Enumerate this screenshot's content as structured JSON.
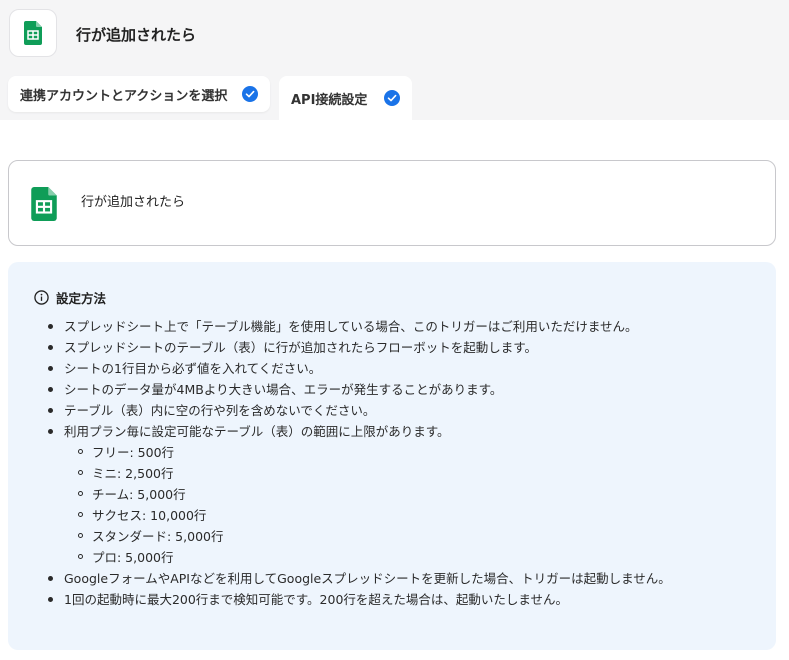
{
  "header": {
    "title": "行が追加されたら",
    "app_icon": "google-sheets-icon"
  },
  "tabs": [
    {
      "label": "連携アカウントとアクションを選択",
      "status_icon": "check-circle-icon",
      "active": false
    },
    {
      "label": "API接続設定",
      "status_icon": "check-circle-icon",
      "active": true
    }
  ],
  "trigger": {
    "label": "行が追加されたら",
    "icon": "google-sheets-icon"
  },
  "info": {
    "title": "設定方法",
    "icon": "info-circle-icon",
    "items": [
      {
        "level": 1,
        "text": "スプレッドシート上で「テーブル機能」を使用している場合、このトリガーはご利用いただけません。"
      },
      {
        "level": 1,
        "text": "スプレッドシートのテーブル（表）に行が追加されたらフローボットを起動します。"
      },
      {
        "level": 1,
        "text": "シートの1行目から必ず値を入れてください。"
      },
      {
        "level": 1,
        "text": "シートのデータ量が4MBより大きい場合、エラーが発生することがあります。"
      },
      {
        "level": 1,
        "text": "テーブル（表）内に空の行や列を含めないでください。"
      },
      {
        "level": 1,
        "text": "利用プラン毎に設定可能なテーブル（表）の範囲に上限があります。"
      },
      {
        "level": 2,
        "text": "フリー: 500行"
      },
      {
        "level": 2,
        "text": "ミニ: 2,500行"
      },
      {
        "level": 2,
        "text": "チーム: 5,000行"
      },
      {
        "level": 2,
        "text": "サクセス: 10,000行"
      },
      {
        "level": 2,
        "text": "スタンダード: 5,000行"
      },
      {
        "level": 2,
        "text": "プロ: 5,000行"
      },
      {
        "level": 1,
        "text": "GoogleフォームやAPIなどを利用してGoogleスプレッドシートを更新した場合、トリガーは起動しません。"
      },
      {
        "level": 1,
        "text": "1回の起動時に最大200行まで検知可能です。200行を超えた場合は、起動いたしません。"
      }
    ]
  },
  "colors": {
    "sheets_green": "#0f9d58",
    "check_blue": "#1a73e8",
    "info_bg": "#eef5fd"
  }
}
